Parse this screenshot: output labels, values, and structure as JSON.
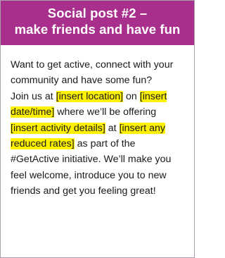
{
  "header": {
    "line1": "Social post #2 –",
    "line2": "make friends and have fun"
  },
  "colors": {
    "header_bg": "#a8308c",
    "highlight": "#fff200"
  },
  "body": {
    "r1": "Want to get active, connect with your",
    "r2": "community and have some fun?",
    "r3a": "Join us at ",
    "r3b": "[insert location]",
    "r3c": " on ",
    "r3d": "[insert",
    "r4a": "date/time]",
    "r4b": " where we’ll be offering",
    "r5a": "[insert activity details]",
    "r5b": " at ",
    "r5c": "[insert any",
    "r6a": "reduced rates]",
    "r6b": " as part of the",
    "r7": "#GetActive initiative. We’ll make you",
    "r8": "feel welcome, introduce you to new",
    "r9": "friends and get you feeling great!"
  }
}
